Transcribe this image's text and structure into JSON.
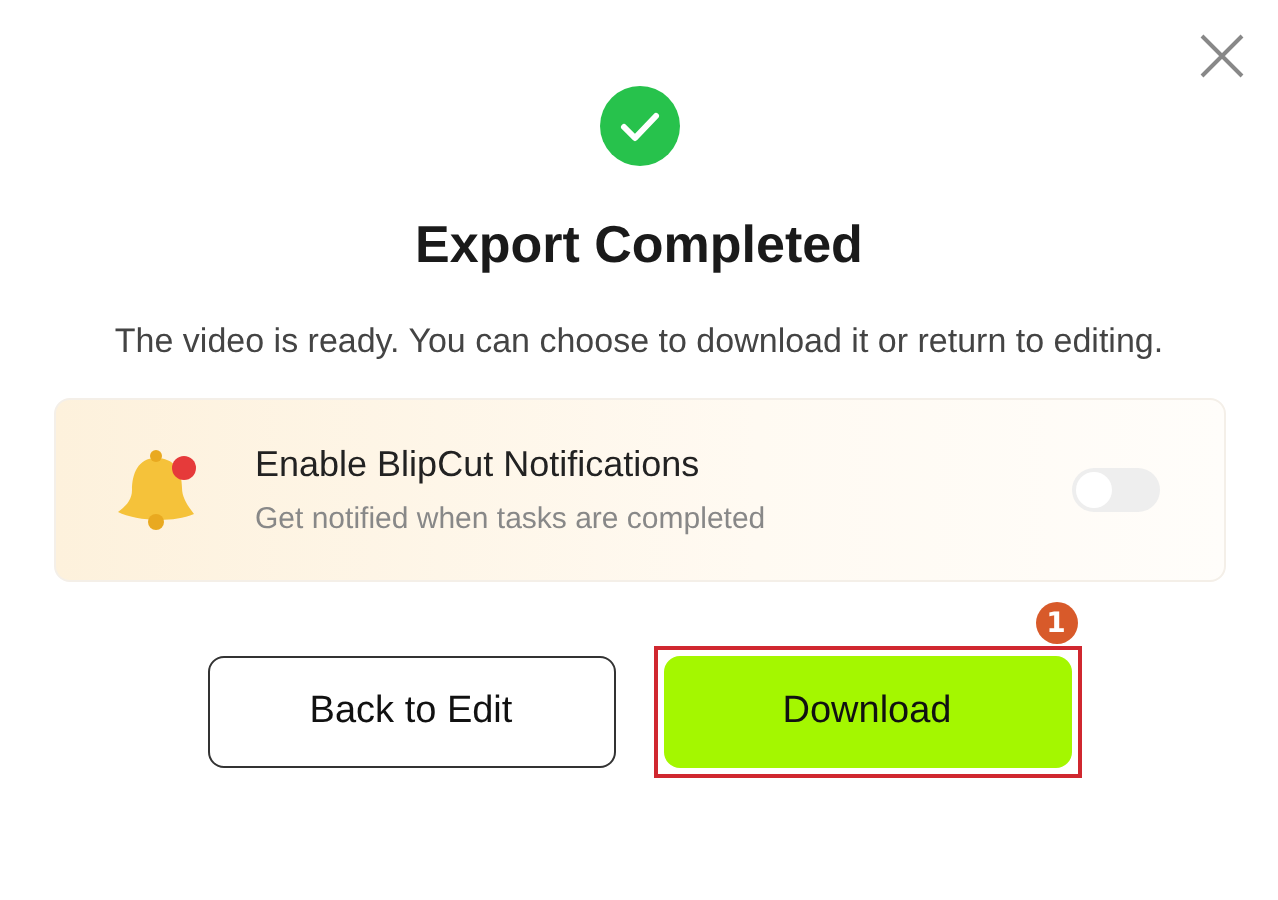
{
  "dialog": {
    "title": "Export Completed",
    "message": "The video is ready. You can choose to download it or return to editing."
  },
  "notification": {
    "title": "Enable BlipCut Notifications",
    "subtitle": "Get notified when tasks are completed",
    "on": false
  },
  "buttons": [
    {
      "label": "Back to Edit",
      "kind": "secondary"
    },
    {
      "label": "Download",
      "kind": "primary",
      "highlighted": true,
      "step": "1"
    }
  ]
}
